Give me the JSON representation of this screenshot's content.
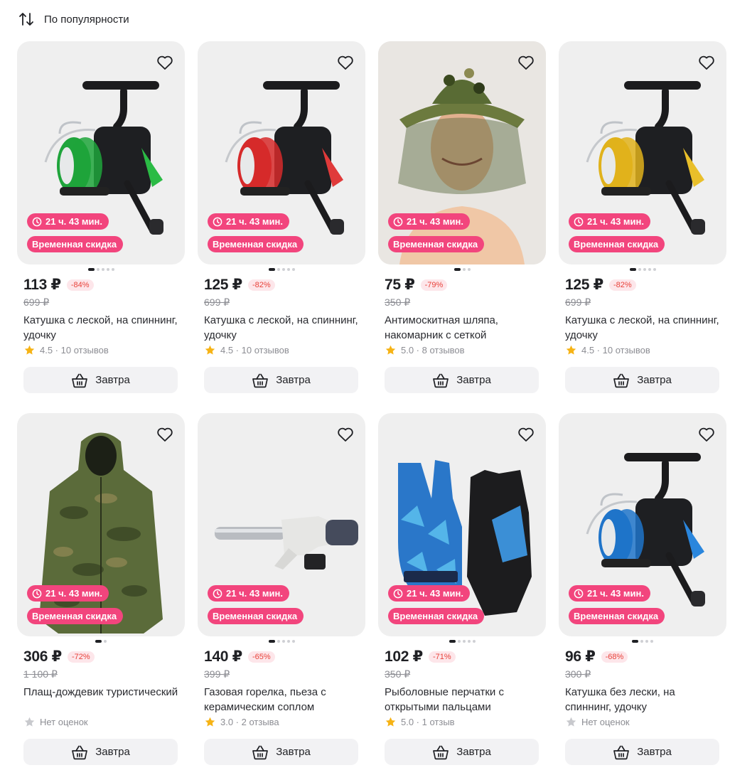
{
  "sort": {
    "label": "По популярности",
    "icon": "sort-arrows-icon"
  },
  "colors": {
    "badge": "#f2457d",
    "discount_text": "#e8423a",
    "discount_bg": "#fde6ea",
    "star": "#f6b315",
    "star_empty": "#c8c9cd"
  },
  "products": [
    {
      "image": "fishing-reel-green",
      "timer": "21 ч. 43 мин.",
      "promo": "Временная скидка",
      "dots": 5,
      "active_dot": 0,
      "price": "113 ₽",
      "discount": "-84%",
      "old_price": "699 ₽",
      "title": "Катушка с леской, на спиннинг, удочку",
      "rating": "4.5 · 10 отзывов",
      "rated": true,
      "cart_label": "Завтра"
    },
    {
      "image": "fishing-reel-red",
      "timer": "21 ч. 43 мин.",
      "promo": "Временная скидка",
      "dots": 5,
      "active_dot": 0,
      "price": "125 ₽",
      "discount": "-82%",
      "old_price": "699 ₽",
      "title": "Катушка с леской, на спиннинг, удочку",
      "rating": "4.5 · 10 отзывов",
      "rated": true,
      "cart_label": "Завтра"
    },
    {
      "image": "mosquito-net-hat",
      "timer": "21 ч. 43 мин.",
      "promo": "Временная скидка",
      "dots": 3,
      "active_dot": 0,
      "price": "75 ₽",
      "discount": "-79%",
      "old_price": "350 ₽",
      "title": "Антимоскитная шляпа, накомарник с сеткой",
      "rating": "5.0 · 8 отзывов",
      "rated": true,
      "cart_label": "Завтра"
    },
    {
      "image": "fishing-reel-gold",
      "timer": "21 ч. 43 мин.",
      "promo": "Временная скидка",
      "dots": 5,
      "active_dot": 0,
      "price": "125 ₽",
      "discount": "-82%",
      "old_price": "699 ₽",
      "title": "Катушка с леской, на спиннинг, удочку",
      "rating": "4.5 · 10 отзывов",
      "rated": true,
      "cart_label": "Завтра"
    },
    {
      "image": "camo-raincoat",
      "timer": "21 ч. 43 мин.",
      "promo": "Временная скидка",
      "dots": 2,
      "active_dot": 0,
      "price": "306 ₽",
      "discount": "-72%",
      "old_price": "1 100 ₽",
      "title": "Плащ-дождевик туристический",
      "rating": "Нет оценок",
      "rated": false,
      "cart_label": "Завтра"
    },
    {
      "image": "gas-torch",
      "timer": "21 ч. 43 мин.",
      "promo": "Временная скидка",
      "dots": 5,
      "active_dot": 0,
      "price": "140 ₽",
      "discount": "-65%",
      "old_price": "399 ₽",
      "title": "Газовая горелка, пьеза с керамическим соплом",
      "rating": "3.0 · 2 отзыва",
      "rated": true,
      "cart_label": "Завтра"
    },
    {
      "image": "fishing-gloves",
      "timer": "21 ч. 43 мин.",
      "promo": "Временная скидка",
      "dots": 5,
      "active_dot": 0,
      "price": "102 ₽",
      "discount": "-71%",
      "old_price": "350 ₽",
      "title": "Рыболовные перчатки с открытыми пальцами",
      "rating": "5.0 · 1 отзыв",
      "rated": true,
      "cart_label": "Завтра"
    },
    {
      "image": "fishing-reel-blue",
      "timer": "21 ч. 43 мин.",
      "promo": "Временная скидка",
      "dots": 4,
      "active_dot": 0,
      "price": "96 ₽",
      "discount": "-68%",
      "old_price": "300 ₽",
      "title": "Катушка без лески, на спиннинг, удочку",
      "rating": "Нет оценок",
      "rated": false,
      "cart_label": "Завтра"
    }
  ]
}
